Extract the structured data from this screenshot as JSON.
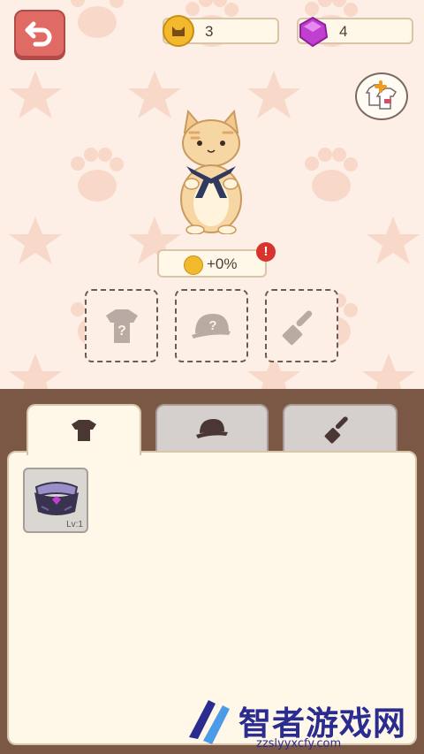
{
  "hud": {
    "coins": "3",
    "gems": "4"
  },
  "bonus": {
    "value": "+0%",
    "alert_mark": "!"
  },
  "slots": [
    {
      "name": "shirt-slot",
      "icon": "shirt-question-icon",
      "mark": "?"
    },
    {
      "name": "hat-slot",
      "icon": "cap-question-icon",
      "mark": "?"
    },
    {
      "name": "tool-slot",
      "icon": "spatula-icon"
    }
  ],
  "tabs": [
    {
      "name": "tab-clothing",
      "icon": "shirt-icon",
      "active": true
    },
    {
      "name": "tab-hats",
      "icon": "cap-icon",
      "active": false
    },
    {
      "name": "tab-tools",
      "icon": "spatula-icon",
      "active": false
    }
  ],
  "inventory": [
    {
      "name": "sailor-collar-item",
      "icon": "collar-icon",
      "level": "Lv:1"
    }
  ],
  "watermark": {
    "title": "智者游戏网",
    "url": "zzslyyxcfy.com"
  },
  "colors": {
    "background": "#fdeee6",
    "accent_red": "#e06a64",
    "coin": "#f2b92c",
    "gem": "#c03fd0",
    "panel_brown": "#7b5845",
    "panel_cream": "#fff8e8"
  }
}
